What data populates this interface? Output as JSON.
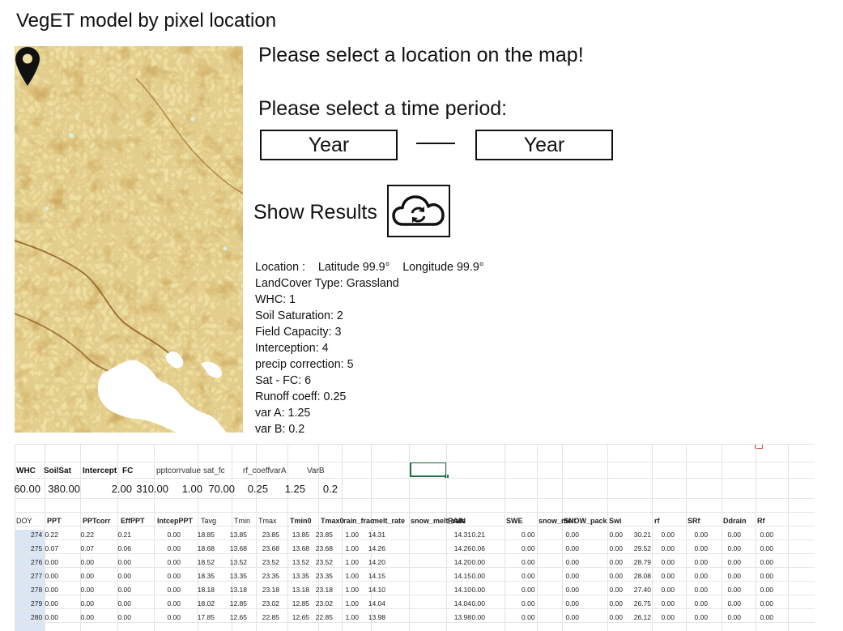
{
  "title": "VegET model by pixel location",
  "prompts": {
    "select_location": "Please select a location on the map!",
    "select_period": "Please select a time period:"
  },
  "year_inputs": {
    "from": "Year",
    "to": "Year"
  },
  "show_results": {
    "label": "Show Results",
    "icon": "cloud-refresh-icon"
  },
  "info": {
    "location_label": "Location :",
    "latitude": "Latitude 99.9°",
    "longitude": "Longitude  99.9°",
    "landcover": "LandCover Type:   Grassland",
    "whc": "WHC:   1",
    "soil_saturation": "Soil Saturation: 2",
    "field_capacity": "Field Capacity: 3",
    "interception": "Interception: 4",
    "precip_correction": "precip correction: 5",
    "sat_fc": "Sat - FC: 6",
    "runoff_coeff": "Runoff coeff: 0.25",
    "var_a": "var A: 1.25",
    "var_b": "var B: 0.2"
  },
  "map": {
    "pin_icon": "map-pin-icon"
  },
  "sheet": {
    "params_headers": [
      "WHC",
      "SoilSat",
      "Intercept",
      "FC",
      "pptcorrvalue",
      "sat_fc",
      "rf_coeff",
      "varA",
      "VarB"
    ],
    "params_values": [
      "60.00",
      "380.00",
      "2.00",
      "310.00",
      "1.00",
      "70.00",
      "0.25",
      "1.25",
      "0.2"
    ],
    "columns": [
      "DOY",
      "PPT",
      "PPTcorr",
      "EffPPT",
      "IntcepPPT",
      "Tavg",
      "Tmin",
      "Tmax",
      "Tmin0",
      "Tmax0",
      "rain_frac",
      "melt_rate",
      "snow_melt_rate",
      "RAIN",
      "SWE",
      "snow_melt",
      "SNOW_pack",
      "Swi",
      "rf",
      "SRf",
      "Ddrain",
      "Rf"
    ],
    "rows": [
      [
        "274",
        "0.22",
        "0.22",
        "0.21",
        "0.00",
        "18.85",
        "13.85",
        "23.85",
        "13.85",
        "23.85",
        "1.00",
        "14.31",
        "14.31",
        "0.21",
        "0.00",
        "0.00",
        "0.00",
        "30.21",
        "0.00",
        "0.00",
        "0.00",
        "0.00"
      ],
      [
        "275",
        "0.07",
        "0.07",
        "0.06",
        "0.00",
        "18.68",
        "13.68",
        "23.68",
        "13.68",
        "23.68",
        "1.00",
        "14.26",
        "14.26",
        "0.06",
        "0.00",
        "0.00",
        "0.00",
        "29.52",
        "0.00",
        "0.00",
        "0.00",
        "0.00"
      ],
      [
        "276",
        "0.00",
        "0.00",
        "0.00",
        "0.00",
        "18.52",
        "13.52",
        "23.52",
        "13.52",
        "23.52",
        "1.00",
        "14.20",
        "14.20",
        "0.00",
        "0.00",
        "0.00",
        "0.00",
        "28.79",
        "0.00",
        "0.00",
        "0.00",
        "0.00"
      ],
      [
        "277",
        "0.00",
        "0.00",
        "0.00",
        "0.00",
        "18.35",
        "13.35",
        "23.35",
        "13.35",
        "23.35",
        "1.00",
        "14.15",
        "14.15",
        "0.00",
        "0.00",
        "0.00",
        "0.00",
        "28.08",
        "0.00",
        "0.00",
        "0.00",
        "0.00"
      ],
      [
        "278",
        "0.00",
        "0.00",
        "0.00",
        "0.00",
        "18.18",
        "13.18",
        "23.18",
        "13.18",
        "23.18",
        "1.00",
        "14.10",
        "14.10",
        "0.00",
        "0.00",
        "0.00",
        "0.00",
        "27.40",
        "0.00",
        "0.00",
        "0.00",
        "0.00"
      ],
      [
        "279",
        "0.00",
        "0.00",
        "0.00",
        "0.00",
        "18.02",
        "12.85",
        "23.02",
        "12.85",
        "23.02",
        "1.00",
        "14.04",
        "14.04",
        "0.00",
        "0.00",
        "0.00",
        "0.00",
        "26.75",
        "0.00",
        "0.00",
        "0.00",
        "0.00"
      ],
      [
        "280",
        "0.00",
        "0.00",
        "0.00",
        "0.00",
        "17.85",
        "12.65",
        "22.85",
        "12.65",
        "22.85",
        "1.00",
        "13.98",
        "13.98",
        "0.00",
        "0.00",
        "0.00",
        "0.00",
        "26.12",
        "0.00",
        "0.00",
        "0.00",
        "0.00"
      ]
    ]
  }
}
